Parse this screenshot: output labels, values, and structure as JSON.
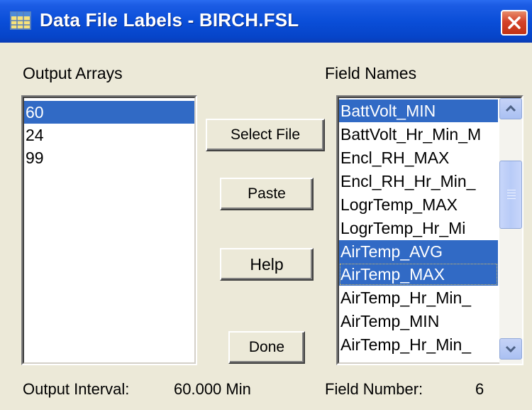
{
  "window": {
    "title": "Data File Labels - BIRCH.FSL"
  },
  "output_arrays": {
    "label": "Output Arrays",
    "items": [
      {
        "text": "60",
        "selected": true
      },
      {
        "text": "24",
        "selected": false
      },
      {
        "text": "99",
        "selected": false
      }
    ]
  },
  "field_names": {
    "label": "Field Names",
    "items": [
      {
        "text": "BattVolt_MIN",
        "selected": true
      },
      {
        "text": "BattVolt_Hr_Min_M",
        "selected": false
      },
      {
        "text": "Encl_RH_MAX",
        "selected": false
      },
      {
        "text": "Encl_RH_Hr_Min_",
        "selected": false
      },
      {
        "text": "LogrTemp_MAX",
        "selected": false
      },
      {
        "text": "LogrTemp_Hr_Mi",
        "selected": false
      },
      {
        "text": "AirTemp_AVG",
        "selected": true
      },
      {
        "text": "AirTemp_MAX",
        "selected": true
      },
      {
        "text": "AirTemp_Hr_Min_",
        "selected": false
      },
      {
        "text": "AirTemp_MIN",
        "selected": false
      },
      {
        "text": "AirTemp_Hr_Min_",
        "selected": false
      }
    ]
  },
  "buttons": {
    "select_file": "Select File",
    "paste": "Paste",
    "help": "Help",
    "done": "Done"
  },
  "footer": {
    "interval_label": "Output Interval:",
    "interval_value": "60.000 Min",
    "field_number_label": "Field Number:",
    "field_number_value": "6"
  },
  "icons": {
    "title": "table-icon",
    "close": "close-icon",
    "scroll_up": "chevron-up-icon",
    "scroll_down": "chevron-down-icon"
  },
  "colors": {
    "titlebar": "#0a4ed8",
    "selection": "#316ac5",
    "face": "#ece9d8",
    "close": "#d4432a"
  }
}
